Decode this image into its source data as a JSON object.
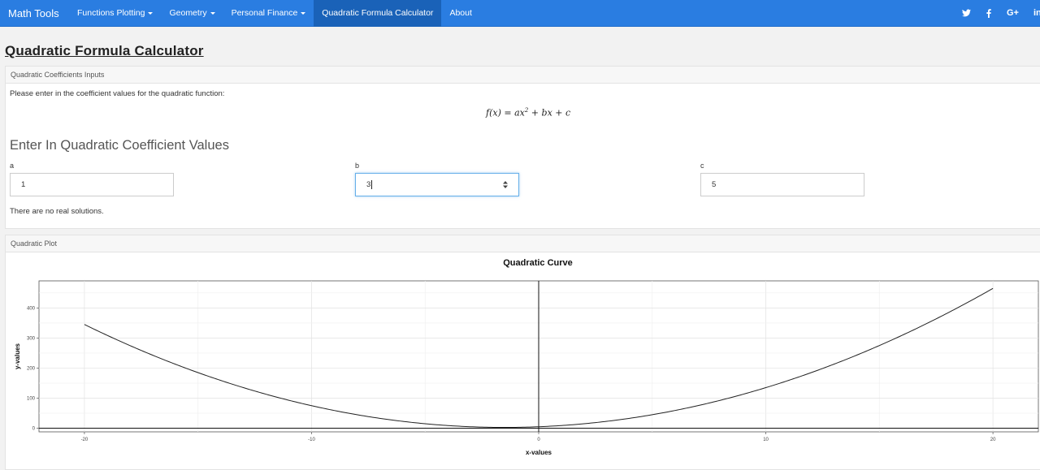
{
  "nav": {
    "brand": "Math Tools",
    "items": [
      {
        "label": "Functions Plotting",
        "dropdown": true
      },
      {
        "label": "Geometry",
        "dropdown": true
      },
      {
        "label": "Personal Finance",
        "dropdown": true
      },
      {
        "label": "Quadratic Formula Calculator",
        "dropdown": false,
        "active": true
      },
      {
        "label": "About",
        "dropdown": false
      }
    ],
    "social": {
      "twitter": "twitter-icon",
      "facebook": "facebook-icon",
      "google_plus": "G+",
      "linkedin": "in"
    }
  },
  "page": {
    "title": "Quadratic Formula Calculator"
  },
  "inputs_panel": {
    "heading": "Quadratic Coefficients Inputs",
    "intro": "Please enter in the coefficient values for the quadratic function:",
    "formula": "f(x) = ax² + bx + c",
    "subheading": "Enter In Quadratic Coefficient Values",
    "fields": [
      {
        "label": "a",
        "value": "1"
      },
      {
        "label": "b",
        "value": "3"
      },
      {
        "label": "c",
        "value": "5"
      }
    ],
    "result": "There are no real solutions."
  },
  "plot_panel": {
    "heading": "Quadratic Plot"
  },
  "chart_data": {
    "type": "line",
    "title": "Quadratic Curve",
    "xlabel": "x-values",
    "ylabel": "y-values",
    "function": {
      "a": 1,
      "b": 3,
      "c": 5
    },
    "x_range": [
      -20,
      20
    ],
    "xlim": [
      -22,
      22
    ],
    "ylim": [
      -12,
      490
    ],
    "x_ticks": [
      -20,
      -10,
      0,
      10,
      20
    ],
    "y_ticks": [
      0,
      100,
      200,
      300,
      400
    ],
    "grid": true,
    "reference_lines": {
      "x": 0,
      "y": 0
    },
    "series": [
      {
        "values_sample": {
          "x": [
            -20,
            -10,
            -1.5,
            0,
            10,
            20
          ],
          "y": [
            345,
            75,
            2.75,
            5,
            135,
            465
          ]
        }
      }
    ]
  }
}
